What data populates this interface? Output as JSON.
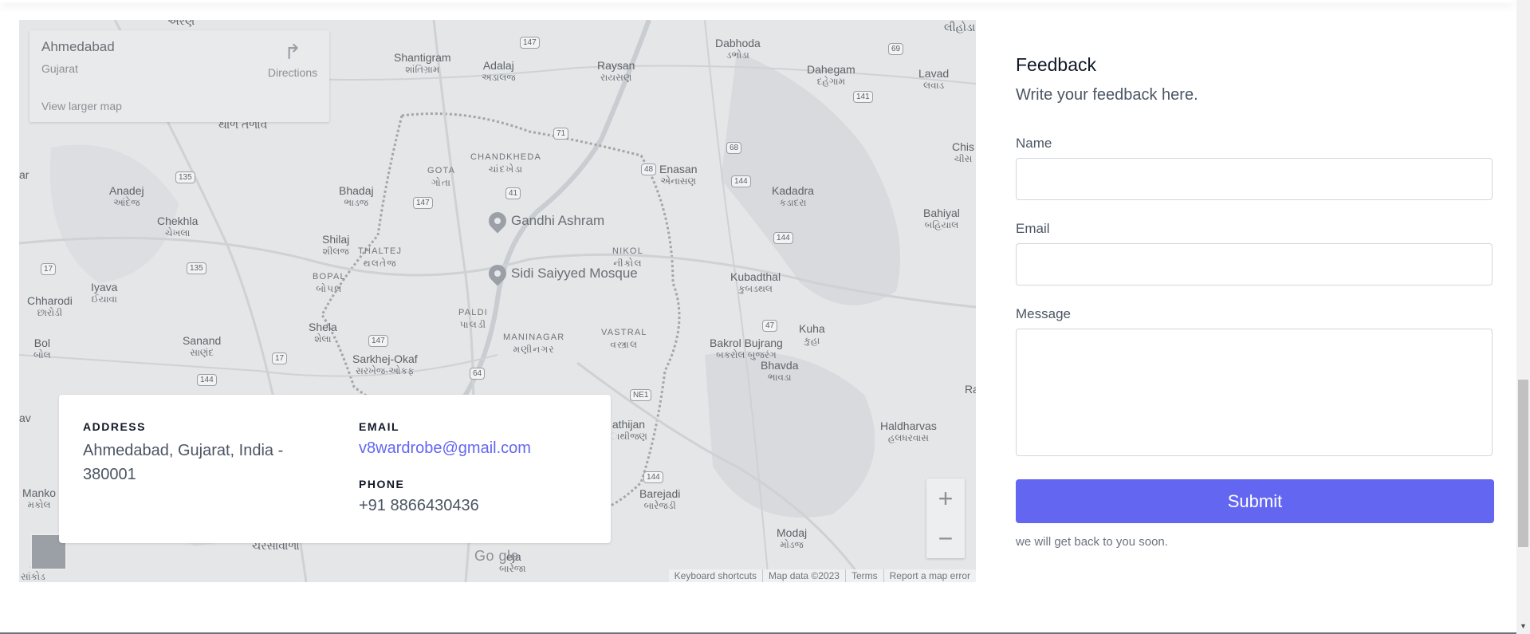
{
  "map": {
    "info": {
      "city": "Ahmedabad",
      "state": "Gujarat",
      "directions_label": "Directions",
      "larger_map_label": "View larger map"
    },
    "places": [
      {
        "name": "Shantigram",
        "sub": "શાંતિગ્રામ"
      },
      {
        "name": "Adalaj",
        "sub": "અડાલજ"
      },
      {
        "name": "Raysan",
        "sub": "રાયસણ"
      },
      {
        "name": "Dabhoda",
        "sub": "ડભોડા"
      },
      {
        "name": "Dahegam",
        "sub": "દહેગામ"
      },
      {
        "name": "Lavad",
        "sub": "લવાડ"
      },
      {
        "name": "CHANDKHEDA",
        "sub": "ચાંદખેડા"
      },
      {
        "name": "GOTA",
        "sub": "ગોતા"
      },
      {
        "name": "Enasan",
        "sub": "એનાસણ"
      },
      {
        "name": "Anadej",
        "sub": "આંદેજ"
      },
      {
        "name": "Bhadaj",
        "sub": "ભાડજ"
      },
      {
        "name": "Kadadra",
        "sub": "કડાદરા"
      },
      {
        "name": "Bahiyal",
        "sub": "બહિયાલ"
      },
      {
        "name": "Chekhla",
        "sub": "ચેખલા"
      },
      {
        "name": "Shilaj",
        "sub": "શીલજ"
      },
      {
        "name": "THALTEJ",
        "sub": "થલતેજ"
      },
      {
        "name": "NIKOL",
        "sub": "નીકોલ"
      },
      {
        "name": "Kubadthal",
        "sub": "કુબડથલ"
      },
      {
        "name": "Iyava",
        "sub": "ઈયાવા"
      },
      {
        "name": "BOPAL",
        "sub": "બોપલ"
      },
      {
        "name": "Chharodi",
        "sub": "છારોડી"
      },
      {
        "name": "Shela",
        "sub": "શેલા"
      },
      {
        "name": "PALDI",
        "sub": "પાલડી"
      },
      {
        "name": "VASTRAL",
        "sub": "વસ્ત્રાલ"
      },
      {
        "name": "Kuha",
        "sub": "કુહા"
      },
      {
        "name": "Bol",
        "sub": "બોલ"
      },
      {
        "name": "Sanand",
        "sub": "સાણંદ"
      },
      {
        "name": "MANINAGAR",
        "sub": "મણીનગર"
      },
      {
        "name": "Bakrol Bujrang",
        "sub": "બકરોલ બુજરંગ"
      },
      {
        "name": "Bhavda",
        "sub": "ભાવડા"
      },
      {
        "name": "Sarkhej-Okaf",
        "sub": "સરખેજ-ઓકફ"
      },
      {
        "name": "Haldharvas",
        "sub": "હલધરવાસ"
      },
      {
        "name": "Barejadi",
        "sub": "બારેજડી"
      },
      {
        "name": "Modaj",
        "sub": "મોડજ"
      },
      {
        "name": "Manko",
        "sub": "મકોલ"
      },
      {
        "name": "Chis",
        "sub": "ચીસ"
      },
      {
        "name": "athijan",
        "sub": "ાથીજણ"
      },
      {
        "name": "ચરસાવાળા",
        "sub": ""
      },
      {
        "name": "થાળ તળાવ",
        "sub": ""
      },
      {
        "name": "લીહોડા",
        "sub": ""
      },
      {
        "name": "અરણ",
        "sub": ""
      },
      {
        "name": "leja",
        "sub": "બારેજા"
      },
      {
        "name": "S",
        "sub": "સાંકોડ"
      },
      {
        "name": "Ra",
        "sub": ""
      },
      {
        "name": "av",
        "sub": ""
      },
      {
        "name": "ar",
        "sub": ""
      }
    ],
    "shields": [
      "147",
      "69",
      "71",
      "68",
      "141",
      "41",
      "147",
      "135",
      "48",
      "144",
      "144",
      "17",
      "135",
      "47",
      "147",
      "17",
      "64",
      "144",
      "NE1",
      "144"
    ],
    "pois": [
      {
        "name": "Gandhi Ashram"
      },
      {
        "name": "Sidi Saiyyed Mosque"
      }
    ],
    "zoom_in": "+",
    "zoom_out": "−",
    "google": "Go gle",
    "footer": [
      "Keyboard shortcuts",
      "Map data ©2023",
      "Terms",
      "Report a map error"
    ]
  },
  "contact": {
    "address_label": "ADDRESS",
    "address_value": "Ahmedabad, Gujarat, India - 380001",
    "email_label": "EMAIL",
    "email_value": "v8wardrobe@gmail.com",
    "phone_label": "PHONE",
    "phone_value": "+91 8866430436"
  },
  "feedback": {
    "title": "Feedback",
    "description": "Write your feedback here.",
    "name_label": "Name",
    "email_label": "Email",
    "message_label": "Message",
    "name_value": "",
    "email_value": "",
    "message_value": "",
    "submit_label": "Submit",
    "note": "we will get back to you soon."
  },
  "colors": {
    "accent": "#6366f1",
    "map_background": "#e5e7eb"
  }
}
